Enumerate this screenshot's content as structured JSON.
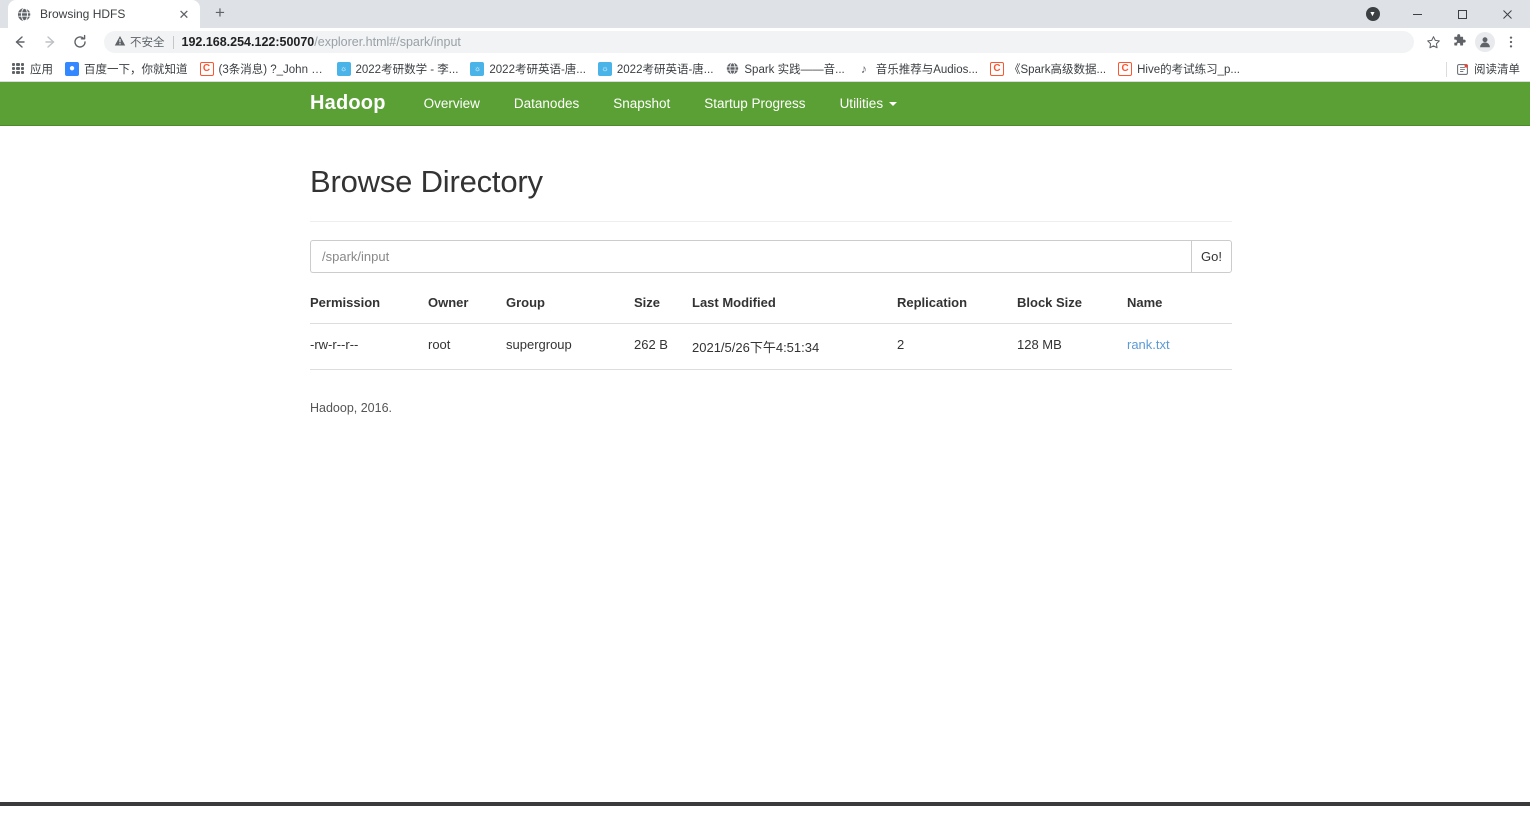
{
  "browser": {
    "tab": {
      "title": "Browsing HDFS",
      "favicon_icon": "globe-icon",
      "close_icon": "close-icon"
    },
    "new_tab_label": "+",
    "window_controls": {
      "update_icon": "update-indicator-icon",
      "minimize_label": "—",
      "maximize_label": "❐",
      "close_label": "✕"
    },
    "toolbar": {
      "back_icon": "back-arrow-icon",
      "forward_icon": "forward-arrow-icon",
      "reload_icon": "reload-icon",
      "security_label": "不安全",
      "security_icon": "warning-triangle-icon",
      "url_host": "192.168.254.122:50070",
      "url_path": "/explorer.html#/spark/input",
      "url_full": "192.168.254.122:50070/explorer.html#/spark/input",
      "bookmark_icon": "star-icon",
      "extensions_icon": "puzzle-piece-icon",
      "profile_icon": "avatar-icon",
      "menu_icon": "three-dot-menu-icon"
    },
    "bookmarks": {
      "apps_icon": "apps-grid-icon",
      "apps_label": "应用",
      "items": [
        {
          "label": "百度一下，你就知道",
          "icon": "baidu-icon",
          "icon_glyph": "熊",
          "icon_color": "#3388ff"
        },
        {
          "label": "(3条消息) ?_John Z...",
          "icon": "csdn-icon",
          "icon_glyph": "C",
          "icon_color": "#fc5531"
        },
        {
          "label": "2022考研数学 - 李...",
          "icon": "bilibili-icon",
          "icon_glyph": "☗",
          "icon_color": "#4ab4e8"
        },
        {
          "label": "2022考研英语-唐...",
          "icon": "bilibili-icon",
          "icon_glyph": "☗",
          "icon_color": "#4ab4e8"
        },
        {
          "label": "2022考研英语-唐...",
          "icon": "bilibili-icon",
          "icon_glyph": "☗",
          "icon_color": "#4ab4e8"
        },
        {
          "label": "Spark 实践——音...",
          "icon": "globe-icon",
          "icon_glyph": "●",
          "icon_color": "#5f6368"
        },
        {
          "label": "音乐推荐与Audios...",
          "icon": "note-icon",
          "icon_glyph": "♪",
          "icon_color": "#5f6368"
        },
        {
          "label": "《Spark高级数据...",
          "icon": "csdn-icon",
          "icon_glyph": "C",
          "icon_color": "#fc5531"
        },
        {
          "label": "Hive的考试练习_p...",
          "icon": "csdn-icon",
          "icon_glyph": "C",
          "icon_color": "#fc5531"
        }
      ],
      "reading_list_label": "阅读清单",
      "reading_list_icon": "reading-list-icon"
    }
  },
  "hadoop": {
    "brand": "Hadoop",
    "accent_color": "#5ba035",
    "nav_items": [
      {
        "label": "Overview",
        "has_caret": false
      },
      {
        "label": "Datanodes",
        "has_caret": false
      },
      {
        "label": "Snapshot",
        "has_caret": false
      },
      {
        "label": "Startup Progress",
        "has_caret": false
      },
      {
        "label": "Utilities",
        "has_caret": true
      }
    ],
    "page_title": "Browse Directory",
    "path_input": {
      "value": "/spark/input",
      "placeholder": "/spark/input"
    },
    "go_button": "Go!",
    "table": {
      "headers": [
        "Permission",
        "Owner",
        "Group",
        "Size",
        "Last Modified",
        "Replication",
        "Block Size",
        "Name"
      ],
      "rows": [
        {
          "permission": "-rw-r--r--",
          "owner": "root",
          "group": "supergroup",
          "size": "262 B",
          "last_modified": "2021/5/26下午4:51:34",
          "replication": "2",
          "block_size": "128 MB",
          "name": "rank.txt"
        }
      ]
    },
    "footer": "Hadoop, 2016."
  }
}
